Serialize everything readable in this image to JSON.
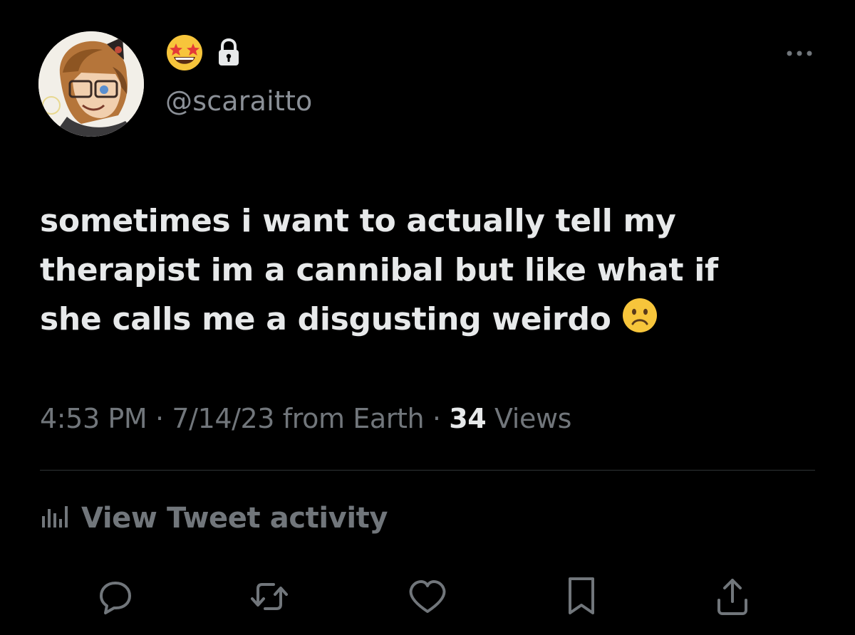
{
  "tweet": {
    "author": {
      "display_name_emojis": [
        "star-struck-emoji",
        "lock-icon"
      ],
      "handle": "@scaraitto"
    },
    "text_lines": [
      "sometimes i want to actually tell my",
      "therapist im a cannibal but like what if",
      "she calls me a disgusting weirdo"
    ],
    "trailing_emoji": "slightly-frowning-face-emoji",
    "meta": {
      "time": "4:53 PM",
      "separator": "·",
      "date": "7/14/23",
      "source": "from Earth",
      "views_count": "34",
      "views_label": "Views"
    },
    "activity_label": "View Tweet activity",
    "actions": [
      "reply-icon",
      "retweet-icon",
      "like-icon",
      "bookmark-icon",
      "share-icon"
    ]
  },
  "colors": {
    "background": "#000000",
    "primary_text": "#e7e9ea",
    "secondary_text": "#71767b",
    "divider": "#2f3336",
    "icon": "#71767b"
  }
}
